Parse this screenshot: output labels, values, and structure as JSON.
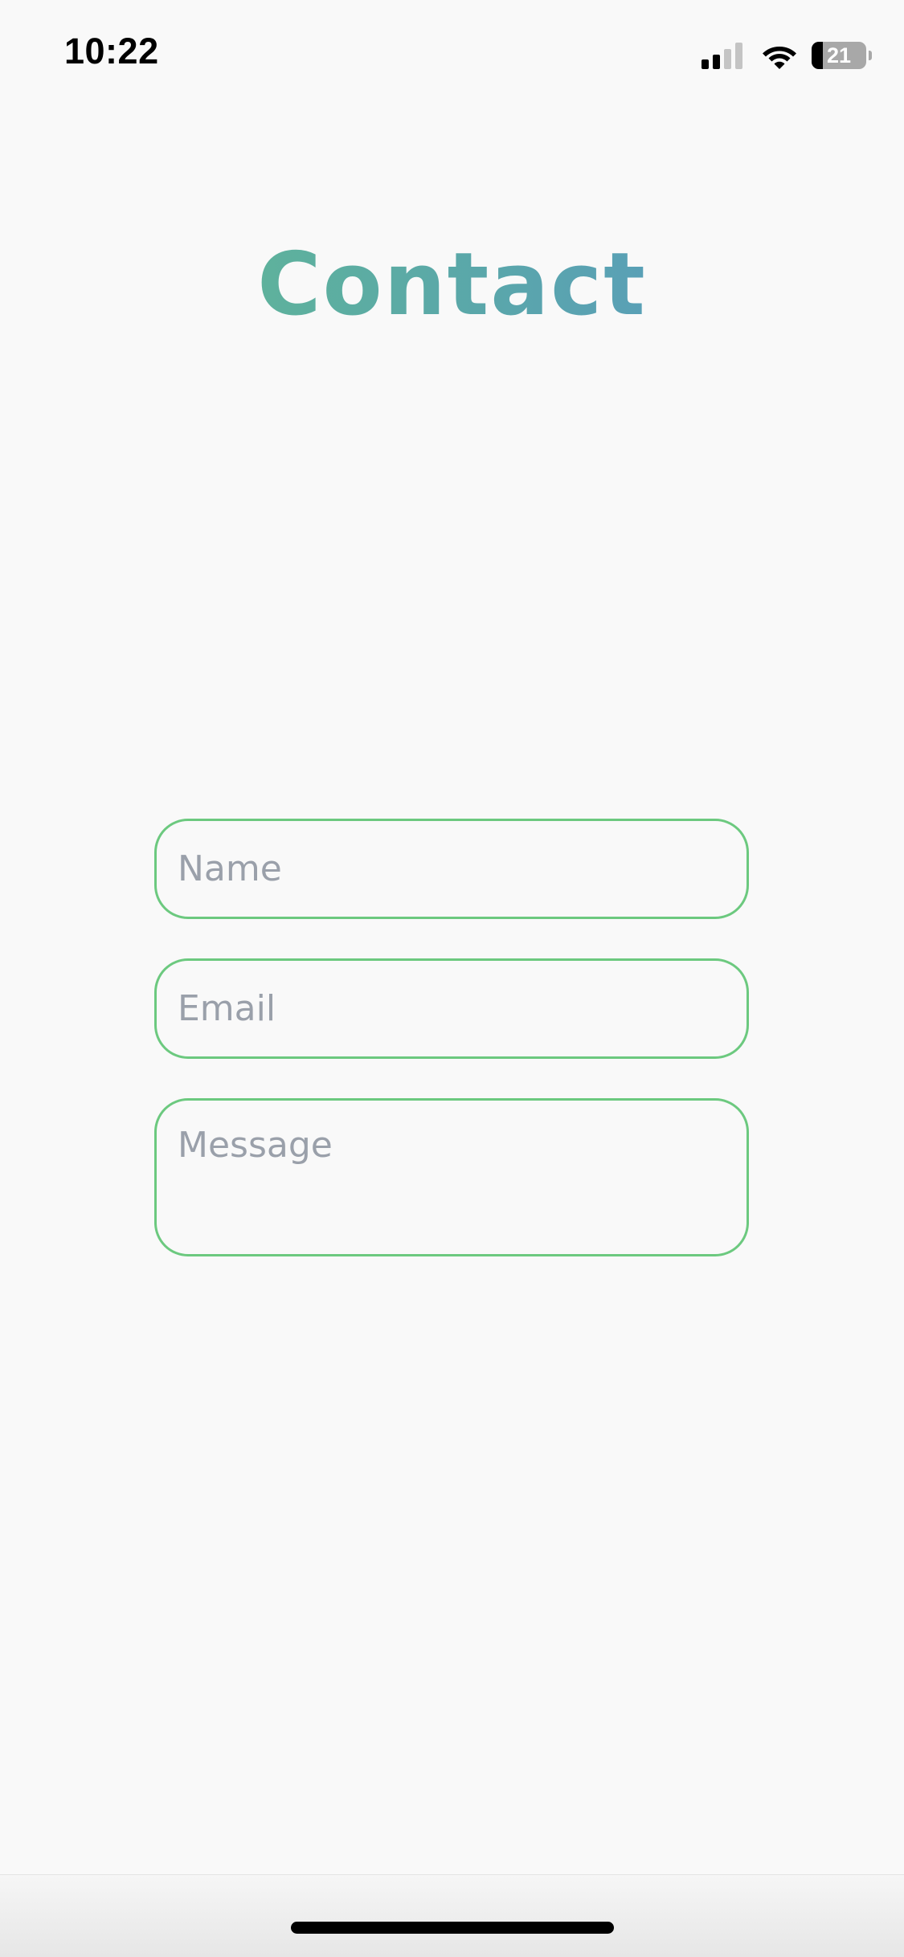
{
  "status_bar": {
    "time": "10:22",
    "battery_level": "21",
    "battery_percent": 21,
    "signal_bars_active": 2,
    "signal_bars_total": 4
  },
  "title": "Contact",
  "title_gradient": [
    "#62be8c",
    "#5896c9"
  ],
  "form": {
    "name_placeholder": "Name",
    "email_placeholder": "Email",
    "message_placeholder": "Message"
  },
  "colors": {
    "background": "#f9f9f9",
    "field_border": "#6cc97f",
    "placeholder": "#9aa0aa"
  },
  "icons": {
    "signal": "cellular-signal-icon",
    "wifi": "wifi-icon",
    "battery": "battery-icon"
  }
}
